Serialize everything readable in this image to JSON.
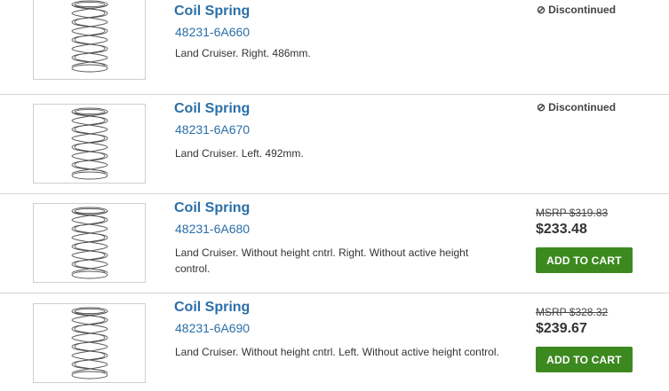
{
  "colors": {
    "link": "#2a6fa8",
    "cart_button": "#3c8a1f"
  },
  "products": [
    {
      "name": "Coil Spring",
      "part_number": "48231-6A660",
      "description": "Land Cruiser. Right. 486mm.",
      "status_icon": "ban-icon",
      "status": "Discontinued"
    },
    {
      "name": "Coil Spring",
      "part_number": "48231-6A670",
      "description": "Land Cruiser. Left. 492mm.",
      "status_icon": "ban-icon",
      "status": "Discontinued"
    },
    {
      "name": "Coil Spring",
      "part_number": "48231-6A680",
      "description": "Land Cruiser. Without height cntrl. Right. Without active height control.",
      "msrp": "MSRP $319.83",
      "price": "$233.48",
      "cart_label": "ADD TO CART"
    },
    {
      "name": "Coil Spring",
      "part_number": "48231-6A690",
      "description": "Land Cruiser. Without height cntrl. Left. Without active height control.",
      "msrp": "MSRP $328.32",
      "price": "$239.67",
      "cart_label": "ADD TO CART"
    }
  ]
}
